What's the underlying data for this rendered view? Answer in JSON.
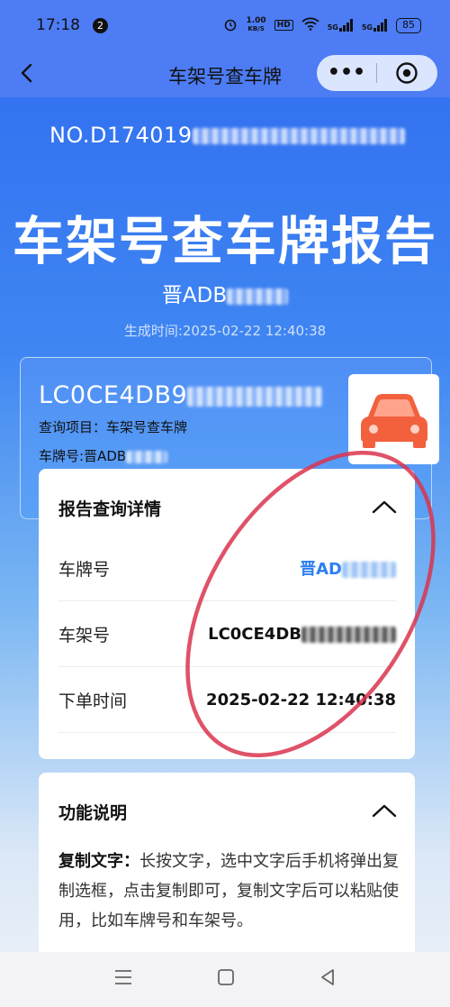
{
  "status": {
    "time": "17:18",
    "notif_count": "2",
    "net_speed": "1.00\nKB/S",
    "net_speed_top": "1.00",
    "net_speed_bottom": "KB/S",
    "hd": "HD",
    "sig1": "5G",
    "sig2": "5G",
    "battery": "85"
  },
  "nav": {
    "title": "车架号查车牌"
  },
  "report": {
    "number_prefix": "NO.D174019",
    "title": "车架号查车牌报告",
    "plate_prefix": "晋ADB",
    "gen_time": "生成时间:2025-02-22 12:40:38"
  },
  "card": {
    "vin_prefix": "LC0CE4DB9",
    "query_item": "查询项目：车架号查车牌",
    "plate_label": "车牌号:晋ADB"
  },
  "details": {
    "heading": "报告查询详情",
    "rows": [
      {
        "label": "车牌号",
        "value": "晋AD"
      },
      {
        "label": "车架号",
        "value": "LC0CE4DB"
      },
      {
        "label": "下单时间",
        "value": "2025-02-22 12:40:38"
      }
    ]
  },
  "func": {
    "heading": "功能说明",
    "bold": "复制文字：",
    "text": "长按文字，选中文字后手机将弹出复制选框，点击复制即可，复制文字后可以粘贴使用，比如车牌号和车架号。"
  },
  "colors": {
    "primary": "#4d7cf4",
    "accent_blue": "#2d7ff0",
    "car_icon": "#f2603e",
    "annotation": "#d9344d"
  }
}
